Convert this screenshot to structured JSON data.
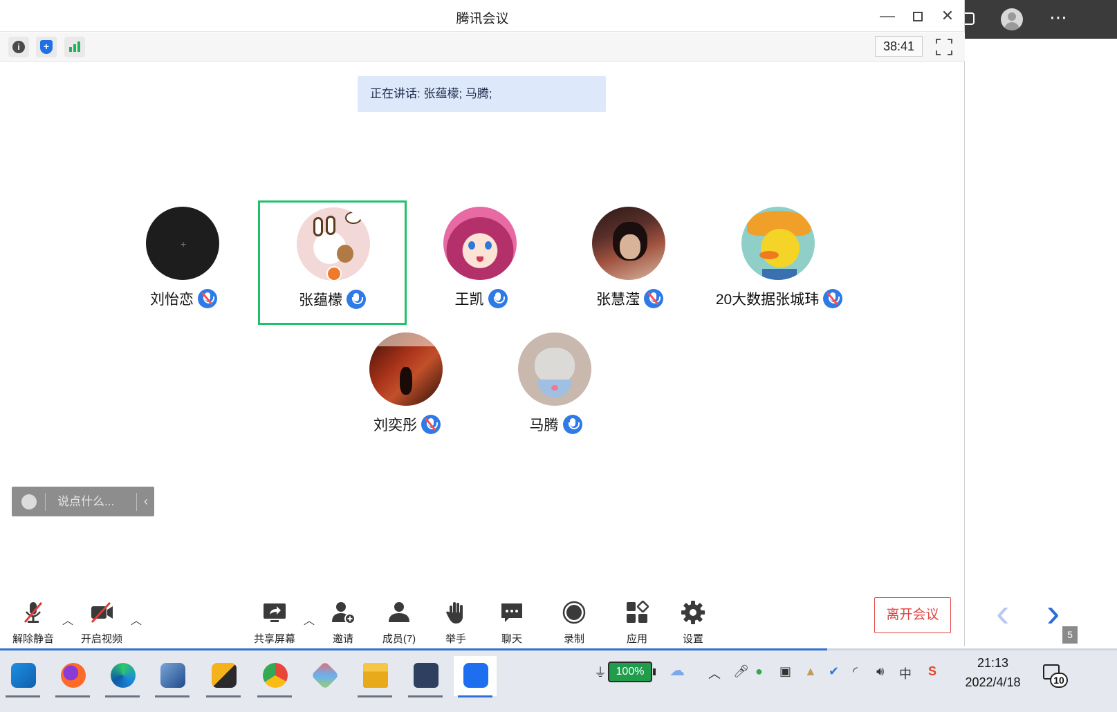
{
  "window": {
    "title": "腾讯会议",
    "timer": "38:41"
  },
  "speaking_banner": "正在讲话: 张蕴檬; 马腾;",
  "participants": [
    {
      "name": "刘怡恋",
      "muted": true
    },
    {
      "name": "张蕴檬",
      "muted": false,
      "host": true,
      "active": true
    },
    {
      "name": "王凯",
      "muted": false
    },
    {
      "name": "张慧滢",
      "muted": true
    },
    {
      "name": "20大数据张城玮",
      "muted": true
    },
    {
      "name": "刘奕彤",
      "muted": true
    },
    {
      "name": "马腾",
      "muted": false
    }
  ],
  "chat": {
    "placeholder": "说点什么..."
  },
  "controls": {
    "unmute": "解除静音",
    "start_video": "开启视频",
    "share_screen": "共享屏幕",
    "invite": "邀请",
    "members": "成员(7)",
    "raise_hand": "举手",
    "chat": "聊天",
    "record": "录制",
    "apps": "应用",
    "settings": "设置",
    "leave": "离开会议"
  },
  "side": {
    "page_number": "5"
  },
  "taskbar": {
    "battery": "100%",
    "ime": "中",
    "time": "21:13",
    "date": "2022/4/18",
    "notifications": "10"
  }
}
